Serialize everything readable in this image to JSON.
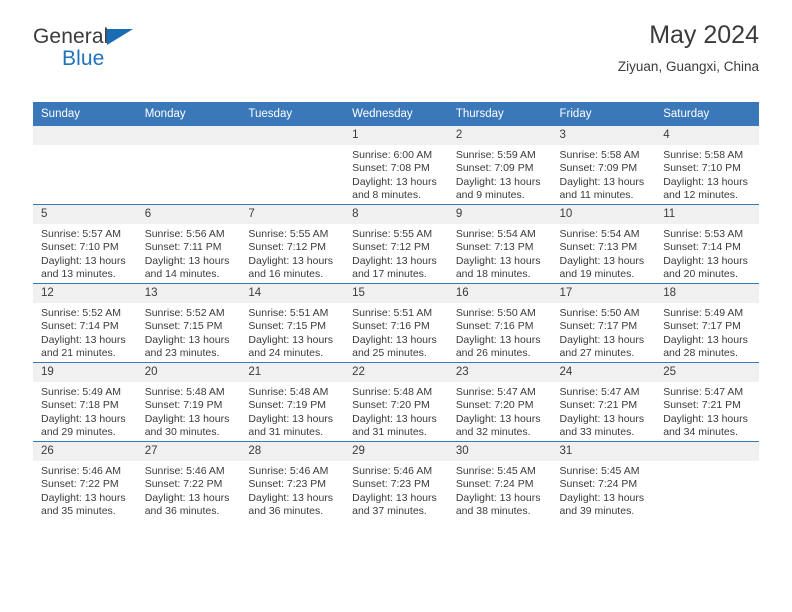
{
  "brand": {
    "line1": "General",
    "line2": "Blue",
    "triangle_color": "#1a6cb5",
    "blue": "#1f73bd"
  },
  "header": {
    "title": "May 2024",
    "location": "Ziyuan, Guangxi, China"
  },
  "theme": {
    "header_blue": "#3a78ba",
    "daynum_band": "#f0f0f0",
    "text": "#3b3b3b"
  },
  "weekday_headers": [
    "Sunday",
    "Monday",
    "Tuesday",
    "Wednesday",
    "Thursday",
    "Friday",
    "Saturday"
  ],
  "weeks": [
    [
      {
        "day": "",
        "empty": true
      },
      {
        "day": "",
        "empty": true
      },
      {
        "day": "",
        "empty": true
      },
      {
        "day": "1",
        "sunrise": "Sunrise: 6:00 AM",
        "sunset": "Sunset: 7:08 PM",
        "daylight": "Daylight: 13 hours and 8 minutes."
      },
      {
        "day": "2",
        "sunrise": "Sunrise: 5:59 AM",
        "sunset": "Sunset: 7:09 PM",
        "daylight": "Daylight: 13 hours and 9 minutes."
      },
      {
        "day": "3",
        "sunrise": "Sunrise: 5:58 AM",
        "sunset": "Sunset: 7:09 PM",
        "daylight": "Daylight: 13 hours and 11 minutes."
      },
      {
        "day": "4",
        "sunrise": "Sunrise: 5:58 AM",
        "sunset": "Sunset: 7:10 PM",
        "daylight": "Daylight: 13 hours and 12 minutes."
      }
    ],
    [
      {
        "day": "5",
        "sunrise": "Sunrise: 5:57 AM",
        "sunset": "Sunset: 7:10 PM",
        "daylight": "Daylight: 13 hours and 13 minutes."
      },
      {
        "day": "6",
        "sunrise": "Sunrise: 5:56 AM",
        "sunset": "Sunset: 7:11 PM",
        "daylight": "Daylight: 13 hours and 14 minutes."
      },
      {
        "day": "7",
        "sunrise": "Sunrise: 5:55 AM",
        "sunset": "Sunset: 7:12 PM",
        "daylight": "Daylight: 13 hours and 16 minutes."
      },
      {
        "day": "8",
        "sunrise": "Sunrise: 5:55 AM",
        "sunset": "Sunset: 7:12 PM",
        "daylight": "Daylight: 13 hours and 17 minutes."
      },
      {
        "day": "9",
        "sunrise": "Sunrise: 5:54 AM",
        "sunset": "Sunset: 7:13 PM",
        "daylight": "Daylight: 13 hours and 18 minutes."
      },
      {
        "day": "10",
        "sunrise": "Sunrise: 5:54 AM",
        "sunset": "Sunset: 7:13 PM",
        "daylight": "Daylight: 13 hours and 19 minutes."
      },
      {
        "day": "11",
        "sunrise": "Sunrise: 5:53 AM",
        "sunset": "Sunset: 7:14 PM",
        "daylight": "Daylight: 13 hours and 20 minutes."
      }
    ],
    [
      {
        "day": "12",
        "sunrise": "Sunrise: 5:52 AM",
        "sunset": "Sunset: 7:14 PM",
        "daylight": "Daylight: 13 hours and 21 minutes."
      },
      {
        "day": "13",
        "sunrise": "Sunrise: 5:52 AM",
        "sunset": "Sunset: 7:15 PM",
        "daylight": "Daylight: 13 hours and 23 minutes."
      },
      {
        "day": "14",
        "sunrise": "Sunrise: 5:51 AM",
        "sunset": "Sunset: 7:15 PM",
        "daylight": "Daylight: 13 hours and 24 minutes."
      },
      {
        "day": "15",
        "sunrise": "Sunrise: 5:51 AM",
        "sunset": "Sunset: 7:16 PM",
        "daylight": "Daylight: 13 hours and 25 minutes."
      },
      {
        "day": "16",
        "sunrise": "Sunrise: 5:50 AM",
        "sunset": "Sunset: 7:16 PM",
        "daylight": "Daylight: 13 hours and 26 minutes."
      },
      {
        "day": "17",
        "sunrise": "Sunrise: 5:50 AM",
        "sunset": "Sunset: 7:17 PM",
        "daylight": "Daylight: 13 hours and 27 minutes."
      },
      {
        "day": "18",
        "sunrise": "Sunrise: 5:49 AM",
        "sunset": "Sunset: 7:17 PM",
        "daylight": "Daylight: 13 hours and 28 minutes."
      }
    ],
    [
      {
        "day": "19",
        "sunrise": "Sunrise: 5:49 AM",
        "sunset": "Sunset: 7:18 PM",
        "daylight": "Daylight: 13 hours and 29 minutes."
      },
      {
        "day": "20",
        "sunrise": "Sunrise: 5:48 AM",
        "sunset": "Sunset: 7:19 PM",
        "daylight": "Daylight: 13 hours and 30 minutes."
      },
      {
        "day": "21",
        "sunrise": "Sunrise: 5:48 AM",
        "sunset": "Sunset: 7:19 PM",
        "daylight": "Daylight: 13 hours and 31 minutes."
      },
      {
        "day": "22",
        "sunrise": "Sunrise: 5:48 AM",
        "sunset": "Sunset: 7:20 PM",
        "daylight": "Daylight: 13 hours and 31 minutes."
      },
      {
        "day": "23",
        "sunrise": "Sunrise: 5:47 AM",
        "sunset": "Sunset: 7:20 PM",
        "daylight": "Daylight: 13 hours and 32 minutes."
      },
      {
        "day": "24",
        "sunrise": "Sunrise: 5:47 AM",
        "sunset": "Sunset: 7:21 PM",
        "daylight": "Daylight: 13 hours and 33 minutes."
      },
      {
        "day": "25",
        "sunrise": "Sunrise: 5:47 AM",
        "sunset": "Sunset: 7:21 PM",
        "daylight": "Daylight: 13 hours and 34 minutes."
      }
    ],
    [
      {
        "day": "26",
        "sunrise": "Sunrise: 5:46 AM",
        "sunset": "Sunset: 7:22 PM",
        "daylight": "Daylight: 13 hours and 35 minutes."
      },
      {
        "day": "27",
        "sunrise": "Sunrise: 5:46 AM",
        "sunset": "Sunset: 7:22 PM",
        "daylight": "Daylight: 13 hours and 36 minutes."
      },
      {
        "day": "28",
        "sunrise": "Sunrise: 5:46 AM",
        "sunset": "Sunset: 7:23 PM",
        "daylight": "Daylight: 13 hours and 36 minutes."
      },
      {
        "day": "29",
        "sunrise": "Sunrise: 5:46 AM",
        "sunset": "Sunset: 7:23 PM",
        "daylight": "Daylight: 13 hours and 37 minutes."
      },
      {
        "day": "30",
        "sunrise": "Sunrise: 5:45 AM",
        "sunset": "Sunset: 7:24 PM",
        "daylight": "Daylight: 13 hours and 38 minutes."
      },
      {
        "day": "31",
        "sunrise": "Sunrise: 5:45 AM",
        "sunset": "Sunset: 7:24 PM",
        "daylight": "Daylight: 13 hours and 39 minutes."
      },
      {
        "day": "",
        "empty": true
      }
    ]
  ]
}
